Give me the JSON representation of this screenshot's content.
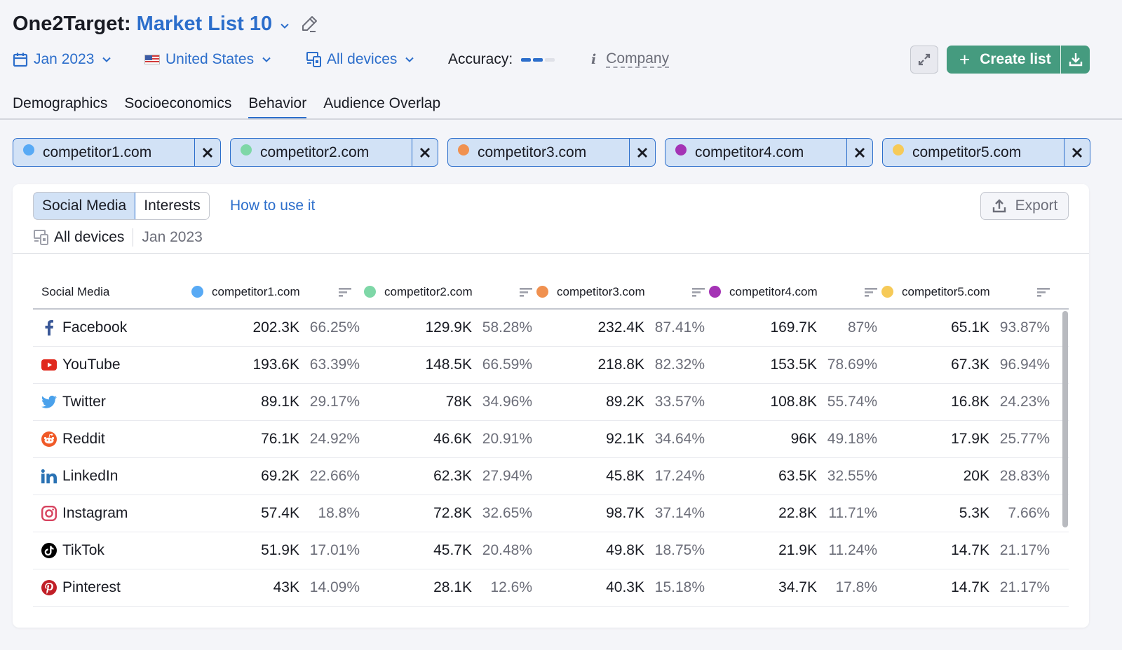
{
  "header": {
    "title_prefix": "One2Target:",
    "list_name": "Market List 10"
  },
  "filters": {
    "date": "Jan 2023",
    "country": "United States",
    "devices": "All devices",
    "accuracy_label": "Accuracy:",
    "accuracy_level": "2 of 3",
    "company_label": "Company",
    "create_list_label": "Create list"
  },
  "tabs": [
    {
      "label": "Demographics",
      "active": false
    },
    {
      "label": "Socioeconomics",
      "active": false
    },
    {
      "label": "Behavior",
      "active": true
    },
    {
      "label": "Audience Overlap",
      "active": false
    }
  ],
  "competitors": [
    {
      "domain": "competitor1.com",
      "color": "#58aaf5"
    },
    {
      "domain": "competitor2.com",
      "color": "#7ed7a7"
    },
    {
      "domain": "competitor3.com",
      "color": "#f09150"
    },
    {
      "domain": "competitor4.com",
      "color": "#a433b5"
    },
    {
      "domain": "competitor5.com",
      "color": "#f6ca58"
    }
  ],
  "card": {
    "segments": [
      {
        "label": "Social Media",
        "active": true
      },
      {
        "label": "Interests",
        "active": false
      }
    ],
    "how_to_label": "How to use it",
    "export_label": "Export",
    "meta_devices": "All devices",
    "meta_date": "Jan 2023"
  },
  "table": {
    "first_column_header": "Social Media",
    "columns": [
      "competitor1.com",
      "competitor2.com",
      "competitor3.com",
      "competitor4.com",
      "competitor5.com"
    ],
    "rows": [
      {
        "name": "Facebook",
        "icon": "facebook-icon",
        "cells": [
          [
            "202.3K",
            "66.25%"
          ],
          [
            "129.9K",
            "58.28%"
          ],
          [
            "232.4K",
            "87.41%"
          ],
          [
            "169.7K",
            "87%"
          ],
          [
            "65.1K",
            "93.87%"
          ]
        ]
      },
      {
        "name": "YouTube",
        "icon": "youtube-icon",
        "cells": [
          [
            "193.6K",
            "63.39%"
          ],
          [
            "148.5K",
            "66.59%"
          ],
          [
            "218.8K",
            "82.32%"
          ],
          [
            "153.5K",
            "78.69%"
          ],
          [
            "67.3K",
            "96.94%"
          ]
        ]
      },
      {
        "name": "Twitter",
        "icon": "twitter-icon",
        "cells": [
          [
            "89.1K",
            "29.17%"
          ],
          [
            "78K",
            "34.96%"
          ],
          [
            "89.2K",
            "33.57%"
          ],
          [
            "108.8K",
            "55.74%"
          ],
          [
            "16.8K",
            "24.23%"
          ]
        ]
      },
      {
        "name": "Reddit",
        "icon": "reddit-icon",
        "cells": [
          [
            "76.1K",
            "24.92%"
          ],
          [
            "46.6K",
            "20.91%"
          ],
          [
            "92.1K",
            "34.64%"
          ],
          [
            "96K",
            "49.18%"
          ],
          [
            "17.9K",
            "25.77%"
          ]
        ]
      },
      {
        "name": "LinkedIn",
        "icon": "linkedin-icon",
        "cells": [
          [
            "69.2K",
            "22.66%"
          ],
          [
            "62.3K",
            "27.94%"
          ],
          [
            "45.8K",
            "17.24%"
          ],
          [
            "63.5K",
            "32.55%"
          ],
          [
            "20K",
            "28.83%"
          ]
        ]
      },
      {
        "name": "Instagram",
        "icon": "instagram-icon",
        "cells": [
          [
            "57.4K",
            "18.8%"
          ],
          [
            "72.8K",
            "32.65%"
          ],
          [
            "98.7K",
            "37.14%"
          ],
          [
            "22.8K",
            "11.71%"
          ],
          [
            "5.3K",
            "7.66%"
          ]
        ]
      },
      {
        "name": "TikTok",
        "icon": "tiktok-icon",
        "cells": [
          [
            "51.9K",
            "17.01%"
          ],
          [
            "45.7K",
            "20.48%"
          ],
          [
            "49.8K",
            "18.75%"
          ],
          [
            "21.9K",
            "11.24%"
          ],
          [
            "14.7K",
            "21.17%"
          ]
        ]
      },
      {
        "name": "Pinterest",
        "icon": "pinterest-icon",
        "cells": [
          [
            "43K",
            "14.09%"
          ],
          [
            "28.1K",
            "12.6%"
          ],
          [
            "40.3K",
            "15.18%"
          ],
          [
            "34.7K",
            "17.8%"
          ],
          [
            "14.7K",
            "21.17%"
          ]
        ]
      }
    ]
  },
  "colors": {
    "accent": "#2c6ecb",
    "primary_button": "#459b7f"
  }
}
